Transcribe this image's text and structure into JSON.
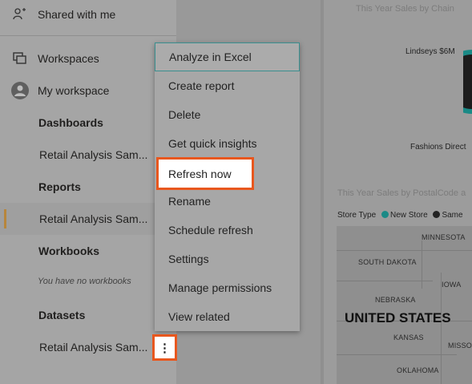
{
  "sidebar": {
    "shared": "Shared with me",
    "workspaces": "Workspaces",
    "my_workspace": "My workspace",
    "dashboards": "Dashboards",
    "dashboard_item": "Retail Analysis Sam...",
    "reports": "Reports",
    "report_item": "Retail Analysis Sam...",
    "workbooks": "Workbooks",
    "no_workbooks": "You have no workbooks",
    "datasets": "Datasets",
    "dataset_item": "Retail Analysis Sam..."
  },
  "context_menu": {
    "items": [
      "Analyze in Excel",
      "Create report",
      "Delete",
      "Get quick insights",
      "Refresh now",
      "Rename",
      "Schedule refresh",
      "Settings",
      "Manage permissions",
      "View related"
    ]
  },
  "kebab": {
    "symbol": "⋮"
  },
  "report": {
    "chart1_title": "This Year Sales by Chain",
    "lindseys": "Lindseys $6M",
    "fashions": "Fashions Direct",
    "chart2_title": "This Year Sales by PostalCode a",
    "legend_title": "Store Type",
    "legend_new": "New Store",
    "legend_same": "Same",
    "new_store_color": "#1a8a86",
    "same_color": "#222222",
    "states": {
      "minnesota": "MINNESOTA",
      "south_dakota": "SOUTH DAKOTA",
      "iowa": "IOWA",
      "nebraska": "NEBRASKA",
      "kansas": "KANSAS",
      "missouri": "MISSO",
      "oklahoma": "OKLAHOMA"
    },
    "country": "UNITED STATES"
  }
}
